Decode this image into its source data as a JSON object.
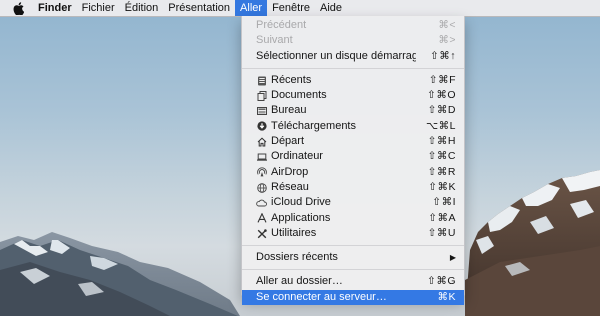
{
  "menubar": {
    "apple_icon": "apple-logo-icon",
    "app_name": "Finder",
    "menus": [
      "Fichier",
      "Édition",
      "Présentation",
      "Aller",
      "Fenêtre",
      "Aide"
    ],
    "active_menu": "Aller",
    "active_color": "#3478e0"
  },
  "go_menu": {
    "nav_items": [
      {
        "label": "Précédent",
        "shortcut": "⌘<",
        "disabled": true
      },
      {
        "label": "Suivant",
        "shortcut": "⌘>",
        "disabled": true
      },
      {
        "label": "Sélectionner un disque démarrage",
        "shortcut": "⇧⌘↑",
        "disabled": false
      }
    ],
    "places": [
      {
        "label": "Récents",
        "shortcut": "⇧⌘F",
        "icon": "recents-icon"
      },
      {
        "label": "Documents",
        "shortcut": "⇧⌘O",
        "icon": "documents-icon"
      },
      {
        "label": "Bureau",
        "shortcut": "⇧⌘D",
        "icon": "desktop-icon"
      },
      {
        "label": "Téléchargements",
        "shortcut": "⌥⌘L",
        "icon": "downloads-icon"
      },
      {
        "label": "Départ",
        "shortcut": "⇧⌘H",
        "icon": "home-icon"
      },
      {
        "label": "Ordinateur",
        "shortcut": "⇧⌘C",
        "icon": "computer-icon"
      },
      {
        "label": "AirDrop",
        "shortcut": "⇧⌘R",
        "icon": "airdrop-icon"
      },
      {
        "label": "Réseau",
        "shortcut": "⇧⌘K",
        "icon": "network-icon"
      },
      {
        "label": "iCloud Drive",
        "shortcut": "⇧⌘I",
        "icon": "icloud-icon"
      },
      {
        "label": "Applications",
        "shortcut": "⇧⌘A",
        "icon": "applications-icon"
      },
      {
        "label": "Utilitaires",
        "shortcut": "⇧⌘U",
        "icon": "utilities-icon"
      }
    ],
    "recent_folders": {
      "label": "Dossiers récents",
      "submenu": "chevron-right-icon"
    },
    "folder_items": [
      {
        "label": "Aller au dossier…",
        "shortcut": "⇧⌘G",
        "selected": false
      },
      {
        "label": "Se connecter au serveur…",
        "shortcut": "⌘K",
        "selected": true
      }
    ],
    "selection_color": "#3479e4"
  }
}
